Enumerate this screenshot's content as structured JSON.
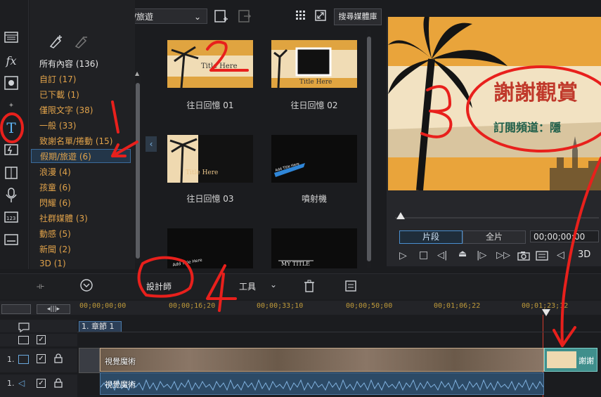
{
  "toolbar": {
    "category_select": "假期/旅遊",
    "search_label": "搜尋媒體庫"
  },
  "categories": [
    {
      "label": "所有內容 (136)",
      "style": "white"
    },
    {
      "label": "自訂  (17)",
      "style": "orange"
    },
    {
      "label": "已下載  (1)",
      "style": "orange"
    },
    {
      "label": "僅限文字  (38)",
      "style": "orange"
    },
    {
      "label": "一般  (33)",
      "style": "orange"
    },
    {
      "label": "致謝名單/捲動  (15)",
      "style": "orange"
    },
    {
      "label": "假期/旅遊  (6)",
      "style": "orange"
    },
    {
      "label": "浪漫  (4)",
      "style": "orange"
    },
    {
      "label": "孩童  (6)",
      "style": "orange"
    },
    {
      "label": "閃耀  (6)",
      "style": "orange"
    },
    {
      "label": "社群媒體  (3)",
      "style": "orange"
    },
    {
      "label": "動感  (5)",
      "style": "orange"
    },
    {
      "label": "新聞  (2)",
      "style": "orange"
    },
    {
      "label": "3D  (1)",
      "style": "orange"
    }
  ],
  "library": {
    "items": [
      {
        "caption": "往日回憶 01"
      },
      {
        "caption": "往日回憶 02"
      },
      {
        "caption": "往日回憶 03"
      },
      {
        "caption": "噴射機"
      }
    ]
  },
  "preview": {
    "title_text": "謝謝觀賞",
    "subtitle_text": "訂閱頻道：隱",
    "tab_clip": "片段",
    "tab_full": "全片",
    "timecode": "00;00;00;00",
    "mode_3d": "3D"
  },
  "timeline": {
    "designer_button": "設計師",
    "tools_button": "工具",
    "ruler": [
      "00;00;00;00",
      "00;00;16;20",
      "00;00;33;10",
      "00;00;50;00",
      "00;01;06;22",
      "00;01;23;12"
    ],
    "chapter": "1. 章節 1",
    "video_track_num": "1.",
    "audio_track_num": "1.",
    "video_clip_label": "視覺魔術",
    "audio_clip_label": "視覺魔術",
    "title_clip_label": "謝謝"
  },
  "annotations": [
    "1",
    "2",
    "3",
    "4"
  ],
  "colors": {
    "accent_blue": "#3b6b9b",
    "orange_text": "#e0a24a",
    "annotation_red": "#e8201c",
    "timecode_gold": "#bf9a3a"
  }
}
